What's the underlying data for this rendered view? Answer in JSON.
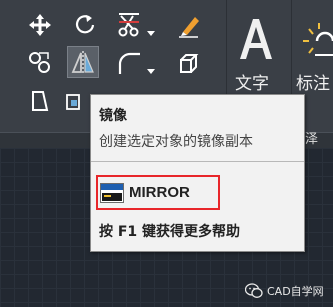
{
  "ribbon": {
    "text_label": "文字",
    "annotation_label": "标注",
    "partial_label": "泽"
  },
  "tooltip": {
    "title": "镜像",
    "description": "创建选定对象的镜像副本",
    "command": "MIRROR",
    "help_text": "按 F1 键获得更多帮助"
  },
  "watermark": {
    "text": "CAD自学网"
  },
  "colors": {
    "ribbon_bg": "#3a3f46",
    "canvas_bg": "#222831",
    "tooltip_bg": "#f2f2f2",
    "highlight_red": "#e8262a"
  },
  "icons": [
    "move-icon",
    "rotate-icon",
    "trim-icon",
    "erase-icon",
    "copy-icon",
    "mirror-icon",
    "fillet-icon",
    "explode-icon",
    "stretch-icon",
    "scale-icon",
    "array-icon",
    "text-icon",
    "dimension-icon",
    "command-icon",
    "wechat-icon"
  ]
}
